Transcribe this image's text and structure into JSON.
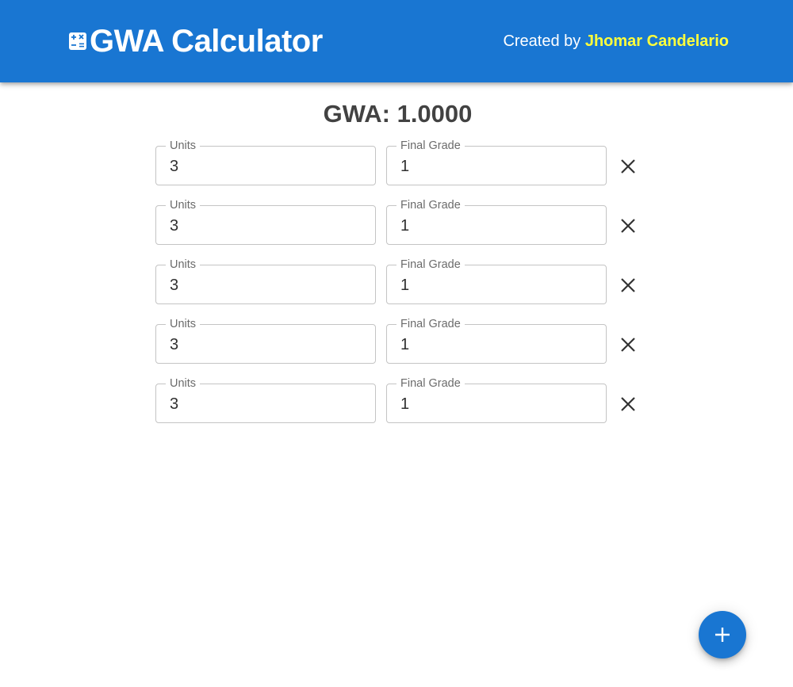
{
  "header": {
    "icon": "calculator-icon",
    "title": "GWA Calculator",
    "credit_prefix": "Created by ",
    "credit_author": "Jhomar Candelario",
    "colors": {
      "appbar": "#1976d2",
      "author_highlight": "#ffff3b"
    }
  },
  "summary": {
    "gwa_text": "GWA: 1.0000"
  },
  "rows": [
    {
      "units_label": "Units",
      "units_value": "3",
      "grade_label": "Final Grade",
      "grade_value": "1",
      "remove_icon": "close-icon"
    },
    {
      "units_label": "Units",
      "units_value": "3",
      "grade_label": "Final Grade",
      "grade_value": "1",
      "remove_icon": "close-icon"
    },
    {
      "units_label": "Units",
      "units_value": "3",
      "grade_label": "Final Grade",
      "grade_value": "1",
      "remove_icon": "close-icon"
    },
    {
      "units_label": "Units",
      "units_value": "3",
      "grade_label": "Final Grade",
      "grade_value": "1",
      "remove_icon": "close-icon"
    },
    {
      "units_label": "Units",
      "units_value": "3",
      "grade_label": "Final Grade",
      "grade_value": "1",
      "remove_icon": "close-icon"
    }
  ],
  "fab": {
    "icon": "plus-icon",
    "color": "#1976d2"
  }
}
